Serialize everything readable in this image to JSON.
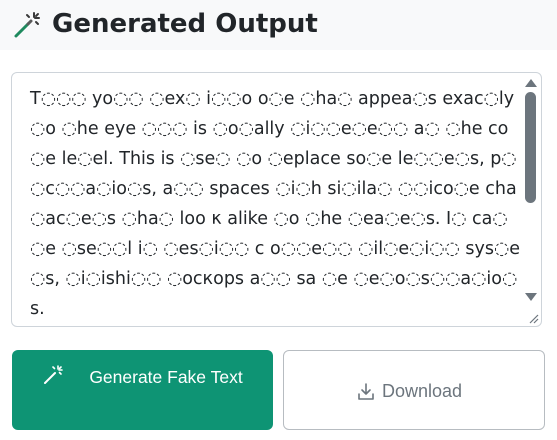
{
  "header": {
    "icon": "magic-wand-icon",
    "title": "Generated Output"
  },
  "output": {
    "text": "T◌◌◌ yo◌◌ ◌ex◌ i◌◌o o◌e ◌ha◌ appea◌s exac◌ly ◌o ◌he eye ◌◌◌ is ◌o◌ally ◌i◌◌e◌e◌◌ a◌ ◌he co◌e le◌el. This is ◌se◌ ◌o ◌eplace so◌e le◌◌e◌s, p◌◌c◌◌a◌io◌s, a◌◌ spaces ◌i◌h si◌ila◌ ◌◌ico◌e cha◌ac◌e◌s ◌ha◌ loo κ alike ◌o ◌he ◌ea◌e◌s. I◌ ca◌ ◌e ◌se◌◌l i◌ ◌es◌i◌◌ c o◌◌e◌◌ ◌il◌e◌i◌◌ sys◌e◌s, ◌i◌ishi◌◌ ◌ocкops a◌◌ sa ◌e ◌e◌o◌s◌◌a◌io◌s."
  },
  "actions": {
    "generate_label": "Generate Fake Text",
    "generate_icon": "magic-wand-icon",
    "download_label": "Download",
    "download_icon": "download-icon"
  },
  "colors": {
    "primary": "#0e9474",
    "muted": "#6c757d",
    "border": "#ced4da"
  }
}
